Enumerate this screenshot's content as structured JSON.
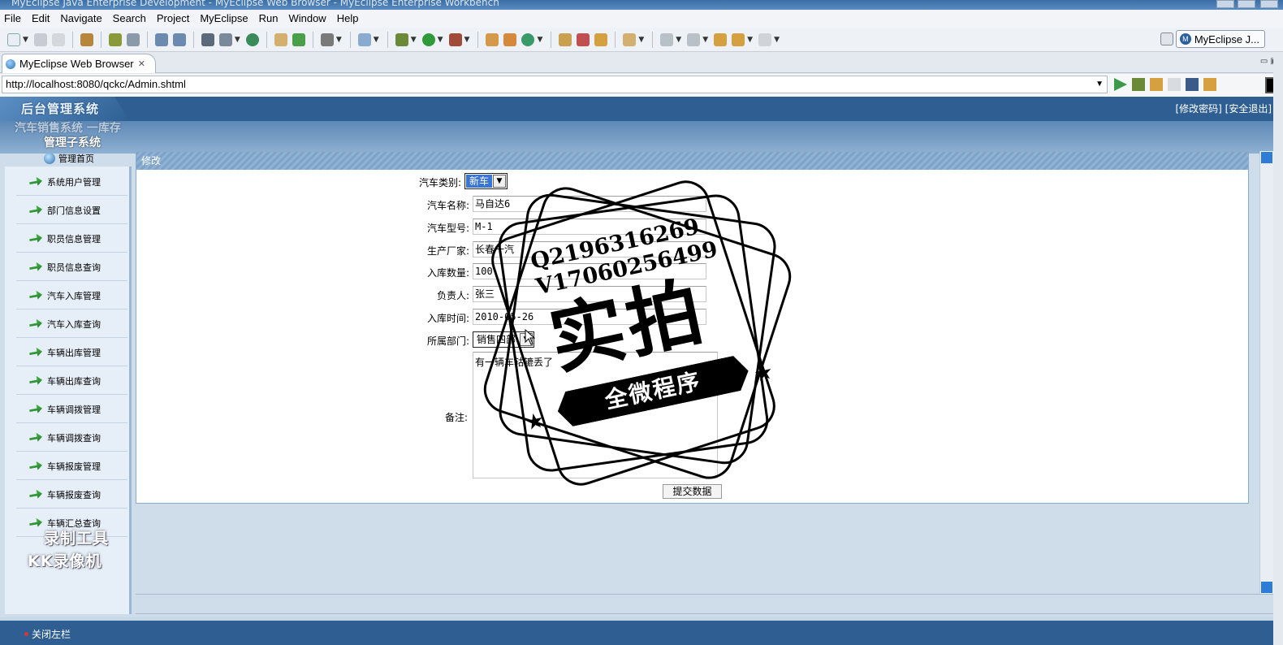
{
  "window": {
    "title": "MyEclipse Java Enterprise Development - MyEclipse Web Browser - MyEclipse Enterprise Workbench"
  },
  "menu": [
    "File",
    "Edit",
    "Navigate",
    "Search",
    "Project",
    "MyEclipse",
    "Run",
    "Window",
    "Help"
  ],
  "perspective": {
    "label": "MyEclipse J..."
  },
  "editor_tab": {
    "label": "MyEclipse Web Browser",
    "close": "✕"
  },
  "browser": {
    "url": "http://localhost:8080/qckc/Admin.shtml"
  },
  "site": {
    "logo_text": "后台管理系统",
    "header_links": "[修改密码] [安全退出]",
    "system_name_line1": "汽车销售系统 一库存",
    "system_name_line2": "管理子系统",
    "home_link": "管理首页"
  },
  "sidebar": {
    "items": [
      {
        "label": "系统用户管理"
      },
      {
        "label": "部门信息设置"
      },
      {
        "label": "职员信息管理"
      },
      {
        "label": "职员信息查询"
      },
      {
        "label": "汽车入库管理"
      },
      {
        "label": "汽车入库查询"
      },
      {
        "label": "车辆出库管理"
      },
      {
        "label": "车辆出库查询"
      },
      {
        "label": "车辆调拨管理"
      },
      {
        "label": "车辆调拨查询"
      },
      {
        "label": "车辆报废管理"
      },
      {
        "label": "车辆报废查询"
      },
      {
        "label": "车辆汇总查询"
      }
    ]
  },
  "watermark_kk": {
    "line1": "录制工具",
    "line2": "KK录像机"
  },
  "content": {
    "title": "修改",
    "form": {
      "car_type": {
        "label": "汽车类别:",
        "value": "新车"
      },
      "car_name": {
        "label": "汽车名称:",
        "value": "马自达6"
      },
      "car_model": {
        "label": "汽车型号:",
        "value": "M-1"
      },
      "manufacturer": {
        "label": "生产厂家:",
        "value": "长春一汽"
      },
      "quantity": {
        "label": "入库数量:",
        "value": "100"
      },
      "person": {
        "label": "负责人:",
        "value": "张三"
      },
      "date": {
        "label": "入库时间:",
        "value": "2010-05-26"
      },
      "department": {
        "label": "所属部门:",
        "value": "销售四部"
      },
      "remark": {
        "label": "备注:",
        "value": "有一辆车轱辘丢了"
      },
      "submit_label": "提交数据"
    }
  },
  "footer": {
    "close_left": "关闭左栏"
  },
  "stamp": {
    "qq": "Q2196316269",
    "wechat": "V17060256499",
    "big_text": "实拍",
    "ribbon_text": "全微程序"
  },
  "colors": {
    "header_blue": "#2f5f92",
    "accent_green": "#2e9a3a",
    "selection_blue": "#3875d7"
  }
}
